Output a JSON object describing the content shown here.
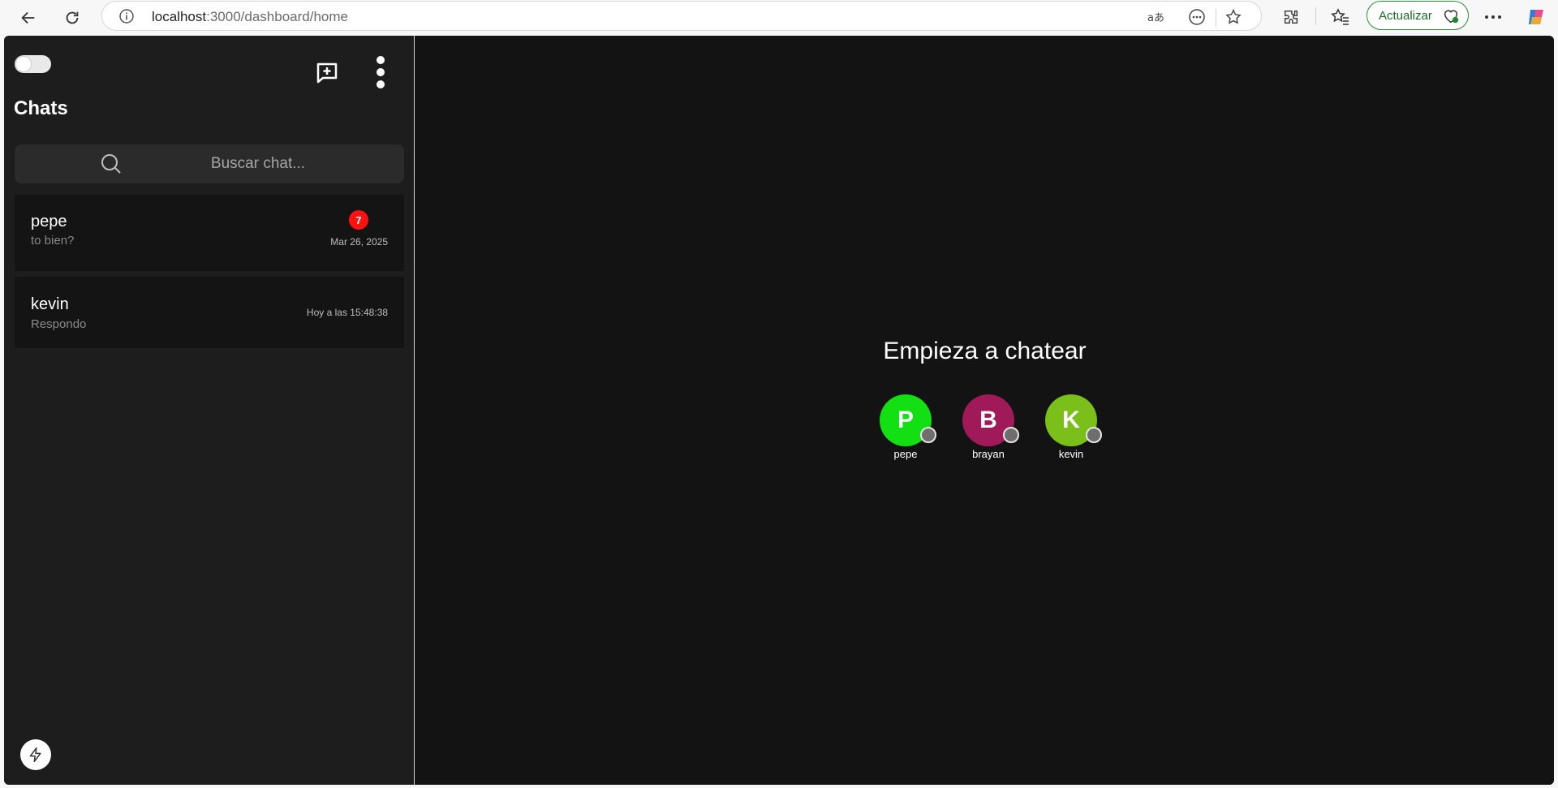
{
  "browser": {
    "url_host": "localhost",
    "url_path": ":3000/dashboard/home",
    "update_label": "Actualizar"
  },
  "sidebar": {
    "title": "Chats",
    "search_placeholder": "Buscar chat...",
    "chats": [
      {
        "name": "pepe",
        "last_message": "to bien?",
        "time": "Mar 26, 2025",
        "unread": "7"
      },
      {
        "name": "kevin",
        "last_message": "Respondo",
        "time": "Hoy a las 15:48:38"
      }
    ]
  },
  "main": {
    "heading": "Empieza a chatear",
    "contacts": [
      {
        "initial": "P",
        "name": "pepe",
        "color": "#12e012"
      },
      {
        "initial": "B",
        "name": "brayan",
        "color": "#a01a5a"
      },
      {
        "initial": "K",
        "name": "kevin",
        "color": "#7abf1a"
      }
    ]
  },
  "colors": {
    "app_bg": "#131313",
    "sidebar_bg": "#1d1d1d",
    "badge": "#ff1111",
    "update_green": "#1b6b28"
  }
}
